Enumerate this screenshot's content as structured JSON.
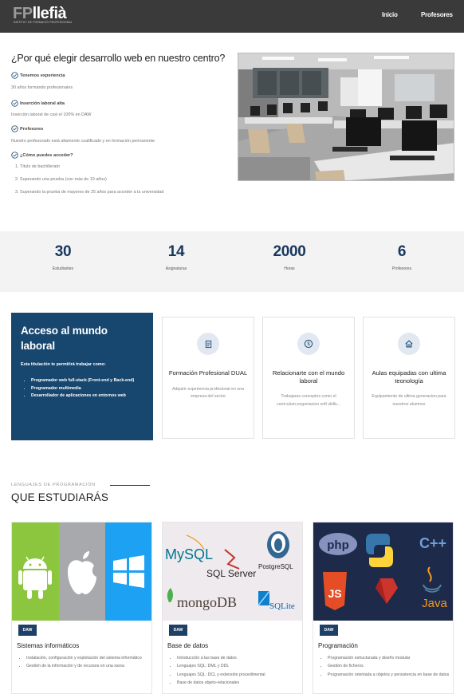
{
  "header": {
    "logo_main": "FPllefià",
    "logo_sub": "INSTITUT DE FORMACIÓ PROFESSIONAL",
    "nav": [
      "Inicio",
      "Profesores"
    ]
  },
  "why": {
    "title": "¿Por qué elegir desarrollo web en nuestro centro?",
    "features": [
      {
        "title": "Tenemos experiencia",
        "desc": "30 años formando profesionales"
      },
      {
        "title": "Inserción laboral alta",
        "desc": "Inserción laboral de casi el 100% en DAW"
      },
      {
        "title": "Profesores",
        "desc": "Nuestro profesorado está altamente cualificado y en formación permanente"
      },
      {
        "title": "¿Cómo puedes acceder?"
      }
    ],
    "access_options": [
      "1. Título de bachillerato",
      "2. Superando una prueba (con más de 19 años)",
      "3. Superando la prueba de mayores de 25 años para acceder a la universidad"
    ]
  },
  "stats": [
    {
      "value": "30",
      "label": "Estudiantes"
    },
    {
      "value": "14",
      "label": "Asignaturas"
    },
    {
      "value": "2000",
      "label": "Horas"
    },
    {
      "value": "6",
      "label": "Profesores"
    }
  ],
  "access": {
    "title": "Acceso al mundo laboral",
    "intro": "Esta titulación te permitirá trabajar como:",
    "items": [
      "Programador web full-stack (Front-end y Back-end)",
      "Programador multimedia",
      "Desarrollador de aplicaciones en entornos web"
    ]
  },
  "features_cards": [
    {
      "title": "Formación Profesional DUAL",
      "desc": "Adquirir experiencia profesional en una empresa del sector",
      "icon": "document-icon"
    },
    {
      "title": "Relacionarte con el mundo laboral",
      "desc": "Trabajaras conceptos como el curriculum,negociacion soft skills...",
      "icon": "dollar-icon"
    },
    {
      "title": "Aulas equipadas con ultima teonología",
      "desc": "Equipamiento de ultima generacion para nuestros alumnos",
      "icon": "home-icon"
    }
  ],
  "study": {
    "kicker": "LENGUAJES DE PROGRAMACIÓN",
    "title": "QUE ESTUDIARÁS"
  },
  "courses": [
    {
      "badge": "DAW",
      "title": "Sistemas informáticos",
      "items": [
        "Instalación, configuración y explotación del sistema informático",
        "Gestión de la información y de recursos en una xarxa"
      ]
    },
    {
      "badge": "DAW",
      "title": "Base de datos",
      "logos": [
        "MySQL",
        "SQL Server",
        "PostgreSQL",
        "mongoDB",
        "SQLite"
      ],
      "items": [
        "Introducción a las base de datos",
        "Lenguajes SQL: DML y DDL",
        "Lenguajes SQL: DCL y extensión procedimental",
        "Base de datos objeto-relacionales"
      ]
    },
    {
      "badge": "DAW",
      "title": "Programación",
      "logos": [
        "php",
        "C++",
        "JS",
        "Java"
      ],
      "items": [
        "Programación estructurada y diseño modular",
        "Gestión de ficheros",
        "Programación orientada a objetos y persistencia en base de datos"
      ]
    }
  ],
  "colors": {
    "header_bg": "#3a3a3a",
    "accent": "#17466e",
    "stat_number": "#17375e",
    "badge": "#1e3f66"
  }
}
